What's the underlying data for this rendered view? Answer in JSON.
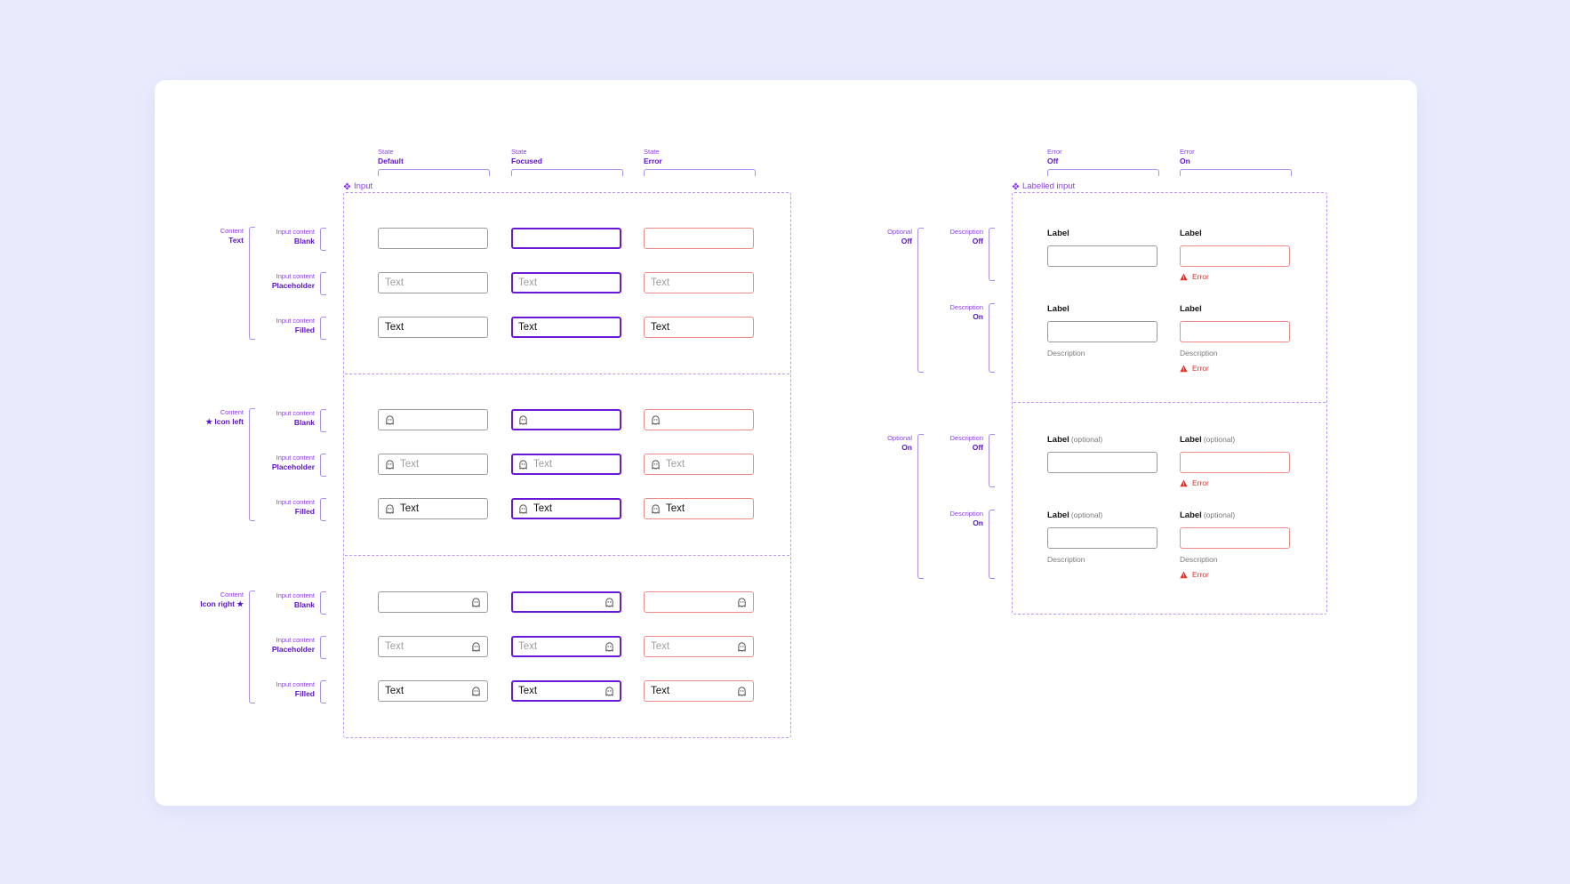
{
  "input_frame": {
    "title": "Input",
    "columns": [
      {
        "key": "State",
        "value": "Default"
      },
      {
        "key": "State",
        "value": "Focused"
      },
      {
        "key": "State",
        "value": "Error"
      }
    ],
    "content_groups": [
      {
        "key": "Content",
        "value": "Text"
      },
      {
        "key": "Content",
        "value": "★ Icon left"
      },
      {
        "key": "Content",
        "value": "Icon right ★"
      }
    ],
    "input_content_rows": [
      {
        "key": "Input content",
        "value": "Blank"
      },
      {
        "key": "Input content",
        "value": "Placeholder"
      },
      {
        "key": "Input content",
        "value": "Filled"
      }
    ],
    "field_text": "Text",
    "field_icon": "ghost-icon"
  },
  "labelled_frame": {
    "title": "Labelled input",
    "columns": [
      {
        "key": "Error",
        "value": "Off"
      },
      {
        "key": "Error",
        "value": "On"
      }
    ],
    "optional_groups": [
      {
        "key": "Optional",
        "value": "Off"
      },
      {
        "key": "Optional",
        "value": "On"
      }
    ],
    "description_rows": [
      {
        "key": "Description",
        "value": "Off"
      },
      {
        "key": "Description",
        "value": "On"
      }
    ],
    "label": "Label",
    "optional_suffix": "(optional)",
    "description": "Description",
    "error_text": "Error",
    "error_icon": "warning-triangle-icon"
  },
  "colors": {
    "background": "#e9ebfd",
    "card": "#ffffff",
    "accent": "#6a18d8",
    "annotation": "#8a3cf5",
    "error": "#e0322d",
    "error_border": "#f28a8a",
    "default_border": "#9a9a9a"
  }
}
